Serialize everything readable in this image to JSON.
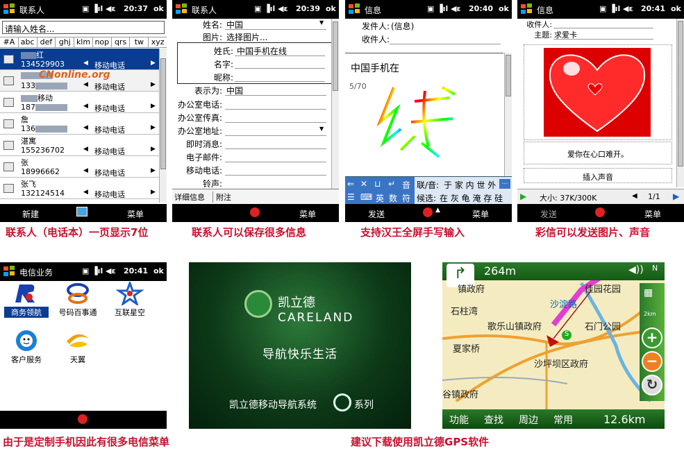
{
  "screens": {
    "contacts": {
      "title": "联系人",
      "time": "20:37",
      "ok": "ok",
      "search": "请输入姓名...",
      "tabs": [
        "#A",
        "abc",
        "def",
        "ghj",
        "klm",
        "nop",
        "qrs",
        "tw",
        "xyz"
      ],
      "rows": [
        {
          "name": "红",
          "phone": "134529903",
          "type": "移动电话"
        },
        {
          "name": "",
          "phone": "133",
          "type": "移动电话"
        },
        {
          "name": "移动",
          "phone": "187",
          "type": "移动电话"
        },
        {
          "name": "詹",
          "phone": "136",
          "type": "移动电话"
        },
        {
          "name": "湛寓",
          "phone": "155236702",
          "type": "移动电话"
        },
        {
          "name": "张",
          "phone": "18996662",
          "type": "移动电话"
        },
        {
          "name": "张飞",
          "phone": "132124514",
          "type": "移动电话"
        }
      ],
      "watermark": "CNonline.org",
      "soft_left": "新建",
      "soft_right": "菜单"
    },
    "contact_edit": {
      "title": "联系人",
      "time": "20:39",
      "ok": "ok",
      "fields": [
        {
          "label": "姓名:",
          "value": "中国"
        },
        {
          "label": "图片:",
          "value": "选择图片..."
        }
      ],
      "popup": [
        {
          "label": "姓氏:",
          "value": "中国手机在线"
        },
        {
          "label": "名字:",
          "value": ""
        },
        {
          "label": "昵称:",
          "value": ""
        }
      ],
      "fields2": [
        {
          "label": "表示为:",
          "value": "中国"
        },
        {
          "label": "办公室电话:",
          "value": ""
        },
        {
          "label": "办公室传真:",
          "value": ""
        },
        {
          "label": "办公室地址:",
          "value": ""
        },
        {
          "label": "即时消息:",
          "value": ""
        },
        {
          "label": "电子邮件:",
          "value": ""
        },
        {
          "label": "移动电话:",
          "value": ""
        },
        {
          "label": "铃声:",
          "value": ""
        }
      ],
      "tabs": [
        "详细信息",
        "附注"
      ],
      "soft_right": "菜单"
    },
    "message": {
      "title": "信息",
      "time": "20:40",
      "ok": "ok",
      "from_label": "发件人:",
      "from_value": "(信息)",
      "to_label": "收件人:",
      "body": "中国手机在",
      "counter": "5/70",
      "handwriting": "线",
      "cand1_prefix": "联/音:",
      "cand1": "于 家 内 世 外",
      "cand2_prefix": "候选:",
      "cand2": "在 灰 龟 淹 存 硅",
      "keys": [
        "英",
        "数",
        "符",
        "音"
      ],
      "soft_left": "发送",
      "soft_right": "菜单"
    },
    "mms": {
      "title": "信息",
      "time": "20:41",
      "ok": "ok",
      "to_label": "收件人:",
      "subject_label": "主题:",
      "subject": "求爱卡",
      "text": "爱你在心口难开。",
      "insert_sound": "插入声音",
      "size": "大小: 37K/300K",
      "page": "1/1",
      "soft_left": "发送",
      "soft_right": "菜单"
    },
    "telecom": {
      "title": "电信业务",
      "time": "20:41",
      "ok": "ok",
      "items": [
        "商务领航",
        "号码百事通",
        "互联星空",
        "客户服务",
        "天翼"
      ]
    },
    "careland": {
      "brand_cn": "凯立德",
      "brand_en": "CARELAND",
      "slogan": "导航快乐生活",
      "product": "凯立德移动导航系统",
      "product_suffix": "系列"
    },
    "gps": {
      "distance": "264m",
      "compass": "N",
      "places": [
        "佳园花园",
        "沙淀路",
        "石柱湾",
        "歌乐山镇政府",
        "石门公园",
        "夏家桥",
        "沙坪坝区政府",
        "镇政府",
        "镇政府",
        "镇政府",
        "谷镇政府"
      ],
      "menu": [
        "功能",
        "查找",
        "周边",
        "常用"
      ],
      "remaining": "12.6km",
      "scale": "2km",
      "s_marker": "S"
    }
  },
  "captions": [
    "联系人（电话本）一页显示7位",
    "联系人可以保存很多信息",
    "支持汉王全屏手写输入",
    "彩信可以发送图片、声音",
    "由于是定制手机因此有很多电信菜单",
    "建议下载使用凯立德GPS软件"
  ],
  "colors": {
    "caption": "#c8102e",
    "selected": "#0a3d91",
    "titlebar": "#000000",
    "map_green": "#3b9b2f"
  }
}
